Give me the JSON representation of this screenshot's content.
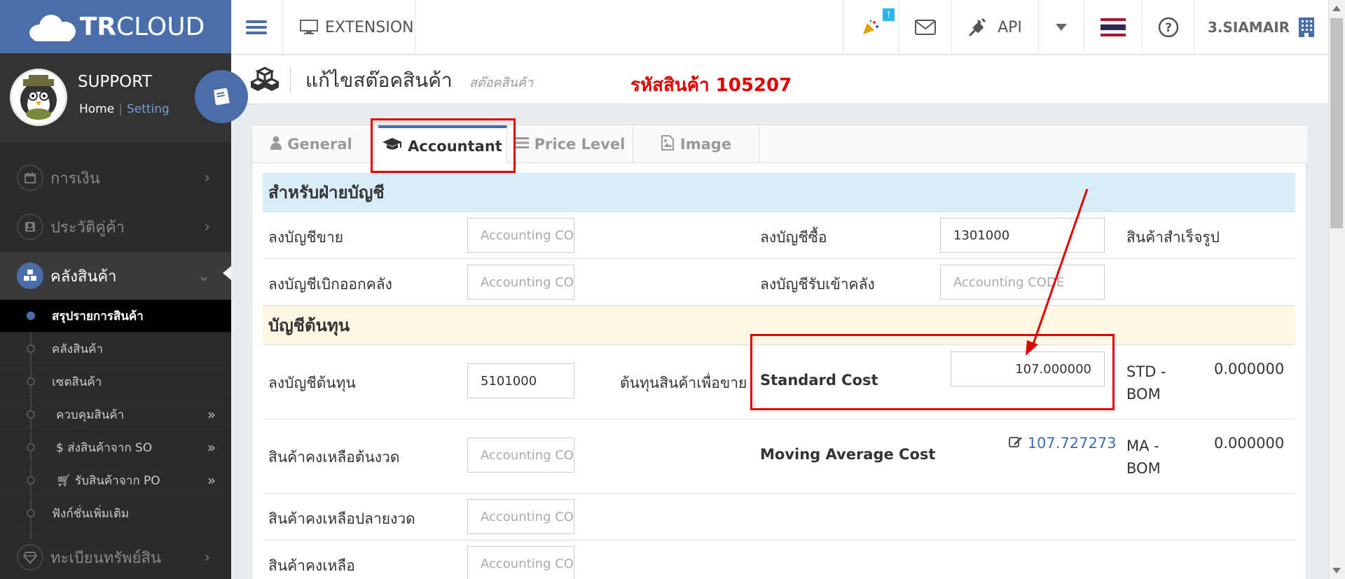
{
  "brand": {
    "logo_bold": "TR",
    "logo_light": "CLOUD"
  },
  "profile": {
    "name": "SUPPORT",
    "home": "Home",
    "sep": "|",
    "setting": "Setting"
  },
  "sidebar": {
    "items": [
      {
        "label": "การเงิน"
      },
      {
        "label": "ประวัติคู่ค้า"
      },
      {
        "label": "คลังสินค้า"
      },
      {
        "label": "ทะเบียนทรัพย์สิน"
      }
    ],
    "subitems": [
      {
        "label": "สรุปรายการสินค้า"
      },
      {
        "label": "คลังสินค้า"
      },
      {
        "label": "เซตสินค้า"
      },
      {
        "label": "ควบคุมสินค้า"
      },
      {
        "label": "$ ส่งสินค้าจาก SO"
      },
      {
        "label": "รับสินค้าจาก PO"
      },
      {
        "label": "ฟังก์ชั่นเพิ่มเติม"
      }
    ]
  },
  "topbar": {
    "extension": "EXTENSION",
    "badge": "!",
    "api": "API",
    "company": "3.SIAMAIR"
  },
  "header": {
    "title": "แก้ไขสต๊อคสินค้า",
    "subtitle": "สต๊อคสินค้า",
    "product_code": "รหัสสินค้า 105207"
  },
  "tabs": [
    {
      "label": "General"
    },
    {
      "label": "Accountant"
    },
    {
      "label": "Price Level"
    },
    {
      "label": "Image"
    }
  ],
  "accounting": {
    "title": "สำหรับฝ่ายบัญชี",
    "sales_label": "ลงบัญชีขาย",
    "sales_placeholder": "Accounting CODE",
    "purchase_label": "ลงบัญชีซื้อ",
    "purchase_value": "1301000",
    "finished_goods": "สินค้าสำเร็จรูป",
    "withdraw_label": "ลงบัญชีเบิกออกคลัง",
    "withdraw_placeholder": "Accounting CODE",
    "receive_label": "ลงบัญชีรับเข้าคลัง",
    "receive_placeholder": "Accounting CODE"
  },
  "cost": {
    "title": "บัญชีต้นทุน",
    "cost_label": "ลงบัญชีต้นทุน",
    "cost_value": "5101000",
    "cost_of_sale": "ต้นทุนสินค้าเพื่อขาย",
    "standard_cost_label": "Standard Cost",
    "standard_cost_value": "107.000000",
    "std_bom_label_1": "STD -",
    "std_bom_label_2": "BOM",
    "std_bom_value": "0.000000",
    "opening_label": "สินค้าคงเหลือต้นงวด",
    "opening_placeholder": "Accounting CODE",
    "mac_label": "Moving Average Cost",
    "mac_value": "107.727273",
    "ma_bom_label_1": "MA -",
    "ma_bom_label_2": "BOM",
    "ma_bom_value": "0.000000",
    "closing_label": "สินค้าคงเหลือปลายงวด",
    "closing_placeholder": "Accounting CODE",
    "remaining_label": "สินค้าคงเหลือ",
    "remaining_placeholder": "Accounting CODE"
  },
  "colors": {
    "accent": "#4a6ea9",
    "highlight": "#e00000",
    "info_bg": "#d9edf7",
    "warn_bg": "#fcf8e3"
  }
}
